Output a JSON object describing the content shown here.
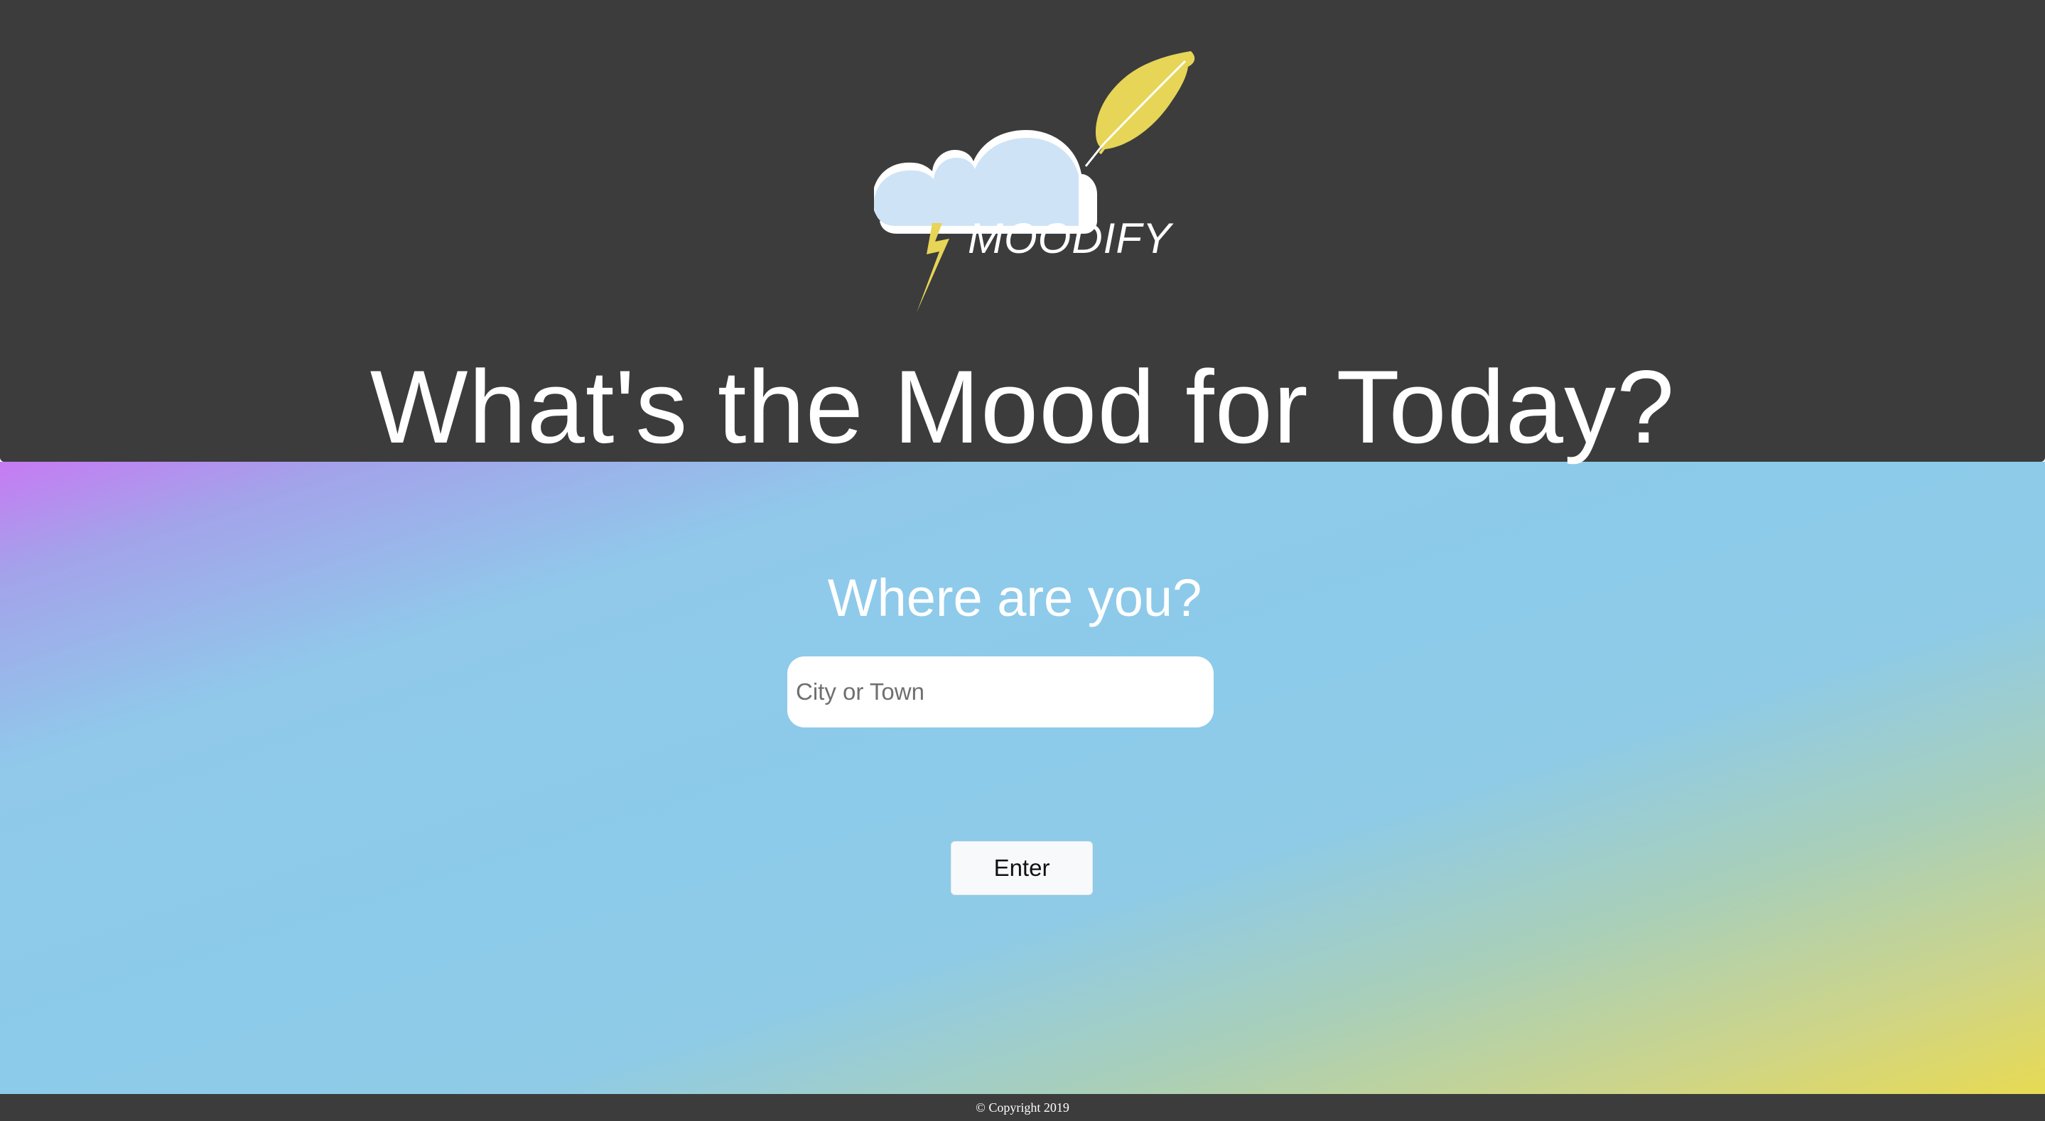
{
  "header": {
    "logo_text": "MOODIFY",
    "headline": "What's the Mood for Today?"
  },
  "main": {
    "question": "Where are you?",
    "location_input": {
      "placeholder": "City or Town",
      "value": ""
    },
    "enter_label": "Enter"
  },
  "footer": {
    "copyright": "© Copyright 2019"
  },
  "colors": {
    "header_bg": "#3c3c3c",
    "cloud": "#cfe3f6",
    "bolt_and_feather": "#e6d557",
    "gradient_start": "#c77af3",
    "gradient_mid": "#8ccbea",
    "gradient_end": "#e7da52"
  }
}
